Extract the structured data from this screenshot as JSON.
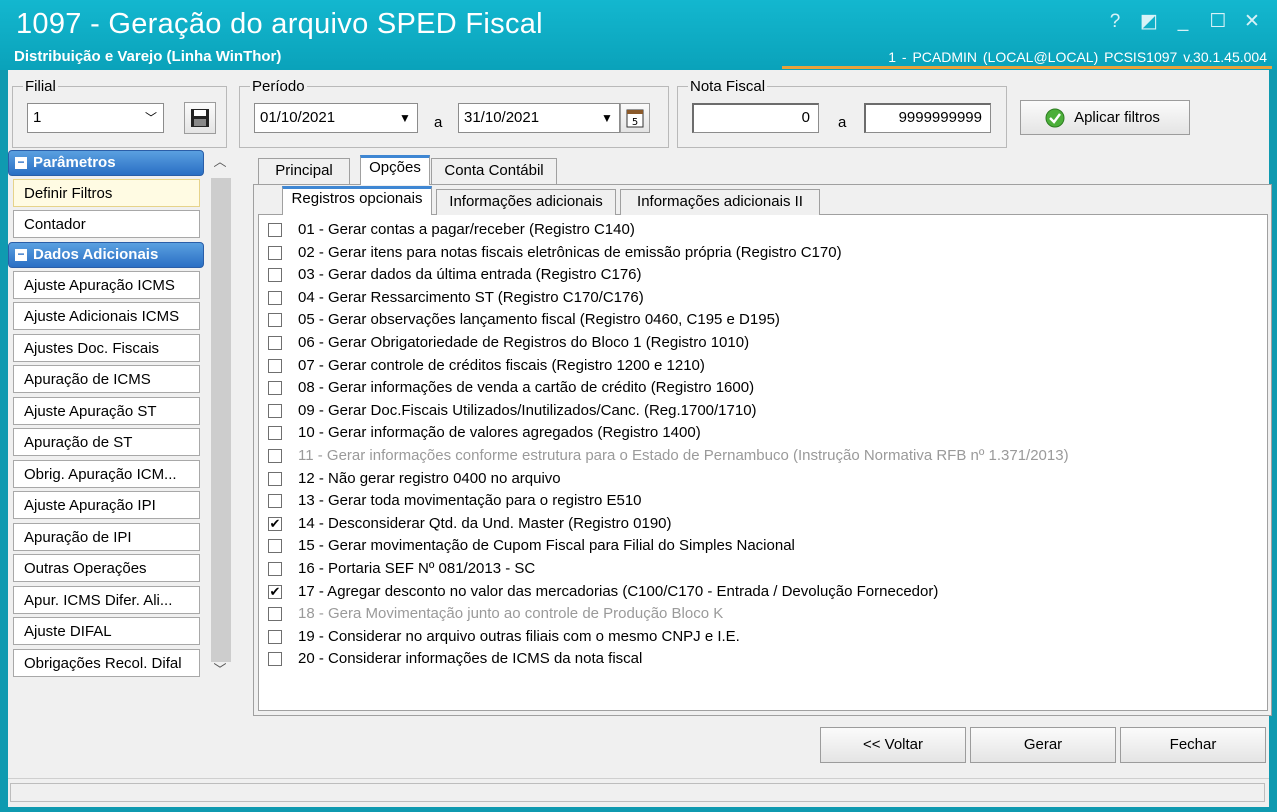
{
  "window": {
    "title": "1097 - Geração do arquivo SPED Fiscal",
    "subtitle": "Distribuição e Varejo (Linha WinThor)",
    "user_info": "1 - PCADMIN (LOCAL@LOCAL)   PCSIS1097  v.30.1.45.004",
    "controls": {
      "help": "?",
      "restore": "◩",
      "minimize": "_",
      "maximize": "☐",
      "close": "✕"
    }
  },
  "filial": {
    "label": "Filial",
    "value": "1",
    "save_icon": "floppy-disk-icon"
  },
  "periodo": {
    "label": "Período",
    "start": "01/10/2021",
    "separator": "a",
    "end": "31/10/2021",
    "calendar_icon": "calendar-icon"
  },
  "nota_fiscal": {
    "label": "Nota Fiscal",
    "from": "0",
    "separator": "a",
    "to": "9999999999"
  },
  "apply_button": {
    "label": "Aplicar filtros",
    "icon": "check-circle-icon"
  },
  "sidebar": {
    "sections": [
      {
        "title": "Parâmetros",
        "items": [
          "Definir Filtros",
          "Contador"
        ]
      },
      {
        "title": "Dados Adicionais",
        "items": [
          "Ajuste Apuração ICMS",
          "Ajuste Adicionais ICMS",
          "Ajustes Doc. Fiscais",
          "Apuração de ICMS",
          "Ajuste Apuração ST",
          "Apuração de ST",
          "Obrig. Apuração ICM...",
          "Ajuste Apuração IPI",
          "Apuração de IPI",
          "Outras Operações",
          "Apur. ICMS Difer. Ali...",
          "Ajuste DIFAL",
          "Obrigações Recol. Difal"
        ]
      }
    ]
  },
  "tabs": [
    "Principal",
    "Opções",
    "Conta Contábil"
  ],
  "subtabs": [
    "Registros opcionais",
    "Informações adicionais",
    "Informações adicionais II"
  ],
  "options": [
    {
      "label": "01 - Gerar contas a pagar/receber (Registro C140)",
      "checked": false,
      "enabled": true
    },
    {
      "label": "02 - Gerar itens para notas fiscais eletrônicas de emissão própria (Registro C170)",
      "checked": false,
      "enabled": true
    },
    {
      "label": "03 - Gerar dados da última entrada (Registro C176)",
      "checked": false,
      "enabled": true
    },
    {
      "label": "04 - Gerar Ressarcimento ST (Registro C170/C176)",
      "checked": false,
      "enabled": true
    },
    {
      "label": "05 - Gerar observações lançamento fiscal (Registro 0460, C195 e D195)",
      "checked": false,
      "enabled": true
    },
    {
      "label": "06 - Gerar Obrigatoriedade de Registros do Bloco 1 (Registro  1010)",
      "checked": false,
      "enabled": true
    },
    {
      "label": "07 - Gerar controle de créditos fiscais (Registro 1200 e 1210)",
      "checked": false,
      "enabled": true
    },
    {
      "label": "08 - Gerar informações de venda a cartão de crédito (Registro 1600)",
      "checked": false,
      "enabled": true
    },
    {
      "label": "09 - Gerar Doc.Fiscais Utilizados/Inutilizados/Canc. (Reg.1700/1710)",
      "checked": false,
      "enabled": true
    },
    {
      "label": "10 - Gerar informação de valores agregados (Registro 1400)",
      "checked": false,
      "enabled": true
    },
    {
      "label": "11 - Gerar informações conforme estrutura para o Estado de Pernambuco (Instrução Normativa RFB nº 1.371/2013)",
      "checked": false,
      "enabled": false
    },
    {
      "label": "12 - Não gerar registro 0400 no arquivo",
      "checked": false,
      "enabled": true
    },
    {
      "label": "13 - Gerar toda movimentação para o registro E510",
      "checked": false,
      "enabled": true
    },
    {
      "label": "14 - Desconsiderar Qtd. da Und. Master (Registro 0190)",
      "checked": true,
      "enabled": true
    },
    {
      "label": "15 - Gerar movimentação de Cupom Fiscal para Filial do Simples Nacional",
      "checked": false,
      "enabled": true
    },
    {
      "label": "16 - Portaria SEF Nº 081/2013 - SC",
      "checked": false,
      "enabled": true
    },
    {
      "label": "17 - Agregar desconto no valor das mercadorias (C100/C170 - Entrada / Devolução Fornecedor)",
      "checked": true,
      "enabled": true
    },
    {
      "label": "18 - Gera Movimentação junto ao controle de Produção Bloco K",
      "checked": false,
      "enabled": false
    },
    {
      "label": "19 - Considerar no arquivo outras filiais com o mesmo CNPJ e I.E.",
      "checked": false,
      "enabled": true
    },
    {
      "label": "20 - Considerar informações de ICMS da nota fiscal",
      "checked": false,
      "enabled": true
    }
  ],
  "footer_buttons": {
    "back": "<< Voltar",
    "generate": "Gerar",
    "close": "Fechar"
  }
}
